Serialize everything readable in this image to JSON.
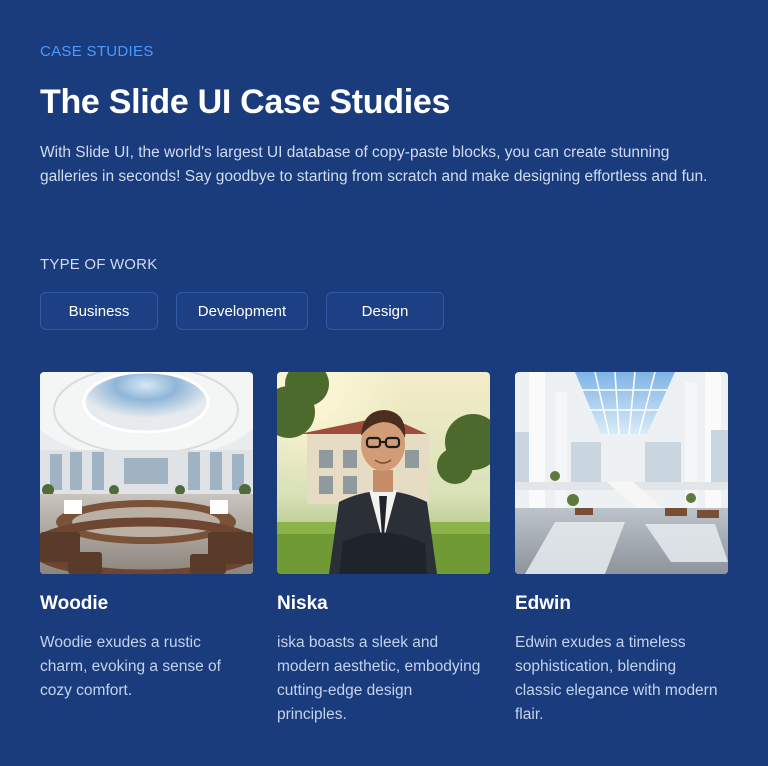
{
  "header": {
    "eyebrow": "CASE STUDIES",
    "title": "The Slide UI Case Studies",
    "intro": "With Slide UI, the world's largest UI database of copy-paste blocks, you can create stunning galleries in seconds! Say goodbye to starting from scratch and make designing effortless and fun."
  },
  "filters": {
    "heading": "TYPE OF WORK",
    "options": [
      "Business",
      "Development",
      "Design"
    ]
  },
  "cards": [
    {
      "name": "Woodie",
      "description": "Woodie exudes a rustic charm, evoking a sense of cozy comfort.",
      "image": "conference-hall-photo"
    },
    {
      "name": "Niska",
      "description": "iska boasts a sleek and modern aesthetic, embodying cutting-edge design principles.",
      "image": "businessman-portrait-photo"
    },
    {
      "name": "Edwin",
      "description": "Edwin exudes a timeless sophistication, blending classic elegance with modern flair.",
      "image": "atrium-interior-photo"
    }
  ],
  "colors": {
    "background": "#1b3c7c",
    "accent": "#4a9bff",
    "chip_border": "#2f5aa8",
    "text_muted": "#cfdcf3"
  }
}
